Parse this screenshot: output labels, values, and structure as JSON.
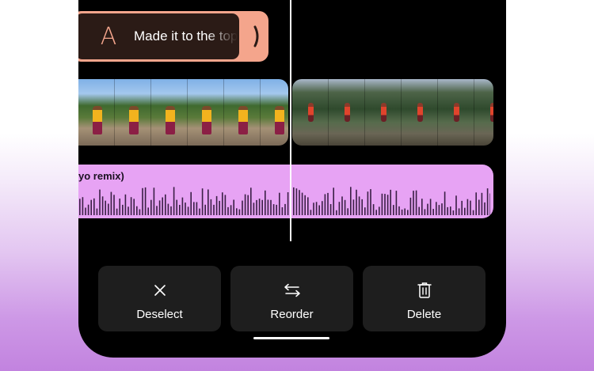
{
  "text_clip": {
    "icon": "text-letter-icon",
    "icon_glyph": "A",
    "text": "Made it to the top"
  },
  "audio": {
    "title": "yo remix)",
    "color": "#e7a3f4"
  },
  "colors": {
    "text_clip_accent": "#f4a58c",
    "background_dark": "#000000",
    "button_bg": "#1e1e1e"
  },
  "actions": [
    {
      "label": "Deselect",
      "icon": "close-icon"
    },
    {
      "label": "Reorder",
      "icon": "swap-arrows-icon"
    },
    {
      "label": "Delete",
      "icon": "trash-icon"
    }
  ]
}
